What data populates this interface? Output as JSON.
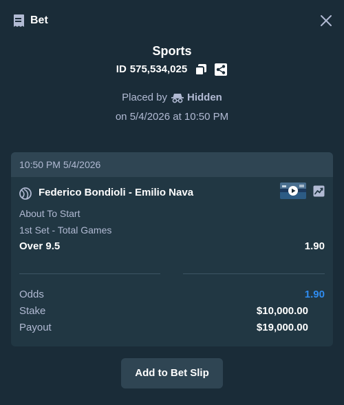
{
  "header": {
    "title": "Bet"
  },
  "summary": {
    "sport": "Sports",
    "id_label": "ID",
    "id_value": "575,534,025",
    "placed_by_label": "Placed by",
    "placed_by_user": "Hidden",
    "placed_on": "on 5/4/2026 at 10:50 PM"
  },
  "card": {
    "timestamp": "10:50 PM 5/4/2026",
    "event_name": "Federico Bondioli - Emilio Nava",
    "status": "About To Start",
    "market": "1st Set - Total Games",
    "outcome": "Over 9.5",
    "outcome_odds": "1.90",
    "odds_label": "Odds",
    "odds_value": "1.90",
    "stake_label": "Stake",
    "stake_value": "$10,000.00",
    "payout_label": "Payout",
    "payout_value": "$19,000.00"
  },
  "actions": {
    "add_to_slip": "Add to Bet Slip"
  },
  "colors": {
    "background": "#1a2c38",
    "card": "#213743",
    "card_header": "#2f4553",
    "muted_text": "#b1bad3",
    "accent_blue": "#2f8cf0"
  },
  "icons": [
    "bet-slip-icon",
    "close-icon",
    "copy-icon",
    "share-icon",
    "incognito-icon",
    "tennis-ball-icon",
    "live-stream-thumbnail",
    "stats-chart-icon"
  ]
}
